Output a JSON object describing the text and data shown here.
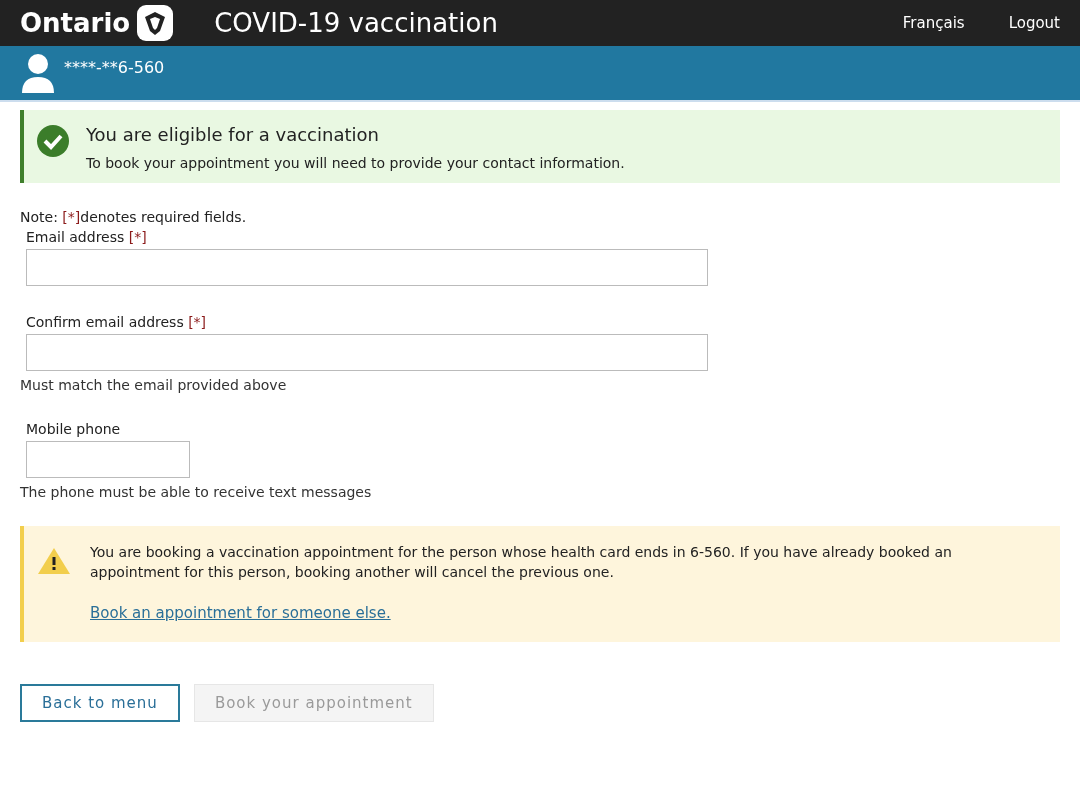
{
  "header": {
    "brand": "Ontario",
    "title": "COVID-19 vaccination",
    "links": [
      "Français",
      "Logout"
    ]
  },
  "user_bar": {
    "card_number": "****-**6-560"
  },
  "success_alert": {
    "title": "You are eligible for a vaccination",
    "message": "To book your appointment you will need to provide your contact information."
  },
  "note": {
    "prefix": "Note: ",
    "mark": "[*]",
    "suffix": "denotes required fields."
  },
  "fields": [
    {
      "label": "Email address",
      "required_mark": "[*]",
      "kind": "wide"
    },
    {
      "label": "Confirm email address",
      "required_mark": "[*]",
      "kind": "wide",
      "hint": "Must match the email provided above"
    },
    {
      "label": "Mobile phone",
      "kind": "narrow",
      "hint": "The phone must be able to receive text messages"
    }
  ],
  "warning_alert": {
    "message": "You are booking a vaccination appointment for the person whose health card ends in 6-560. If you have already booked an appointment for this person, booking another will cancel the previous one.",
    "link": "Book an appointment for someone else."
  },
  "buttons": [
    {
      "label": "Back to menu",
      "disabled": false
    },
    {
      "label": "Book your appointment",
      "disabled": true
    }
  ]
}
